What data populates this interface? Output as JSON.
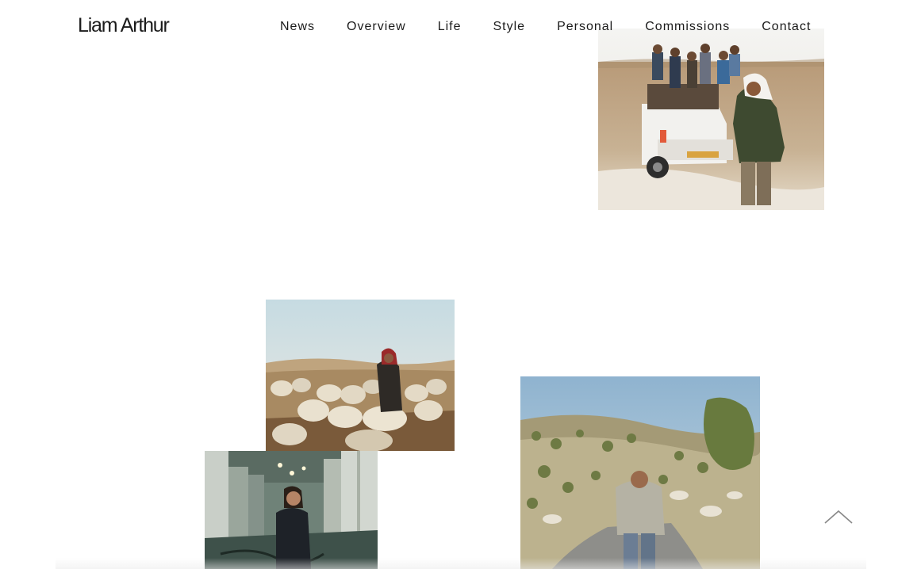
{
  "site": {
    "title": "Liam Arthur"
  },
  "nav": {
    "items": [
      {
        "label": "News"
      },
      {
        "label": "Overview"
      },
      {
        "label": "Life"
      },
      {
        "label": "Style"
      },
      {
        "label": "Personal"
      },
      {
        "label": "Commissions"
      },
      {
        "label": "Contact"
      }
    ]
  },
  "gallery": {
    "photos": [
      {
        "id": "truck",
        "subject": "man standing beside pickup truck with children in desert"
      },
      {
        "id": "sheep",
        "subject": "woman herding sheep in desert"
      },
      {
        "id": "winery",
        "subject": "woman standing in winery tank room"
      },
      {
        "id": "road",
        "subject": "man standing on road among olive hills"
      }
    ]
  },
  "icons": {
    "back_to_top": "chevron-up-icon"
  },
  "colors": {
    "text": "#1b1b1b",
    "background": "#ffffff",
    "icon": "#888888"
  }
}
